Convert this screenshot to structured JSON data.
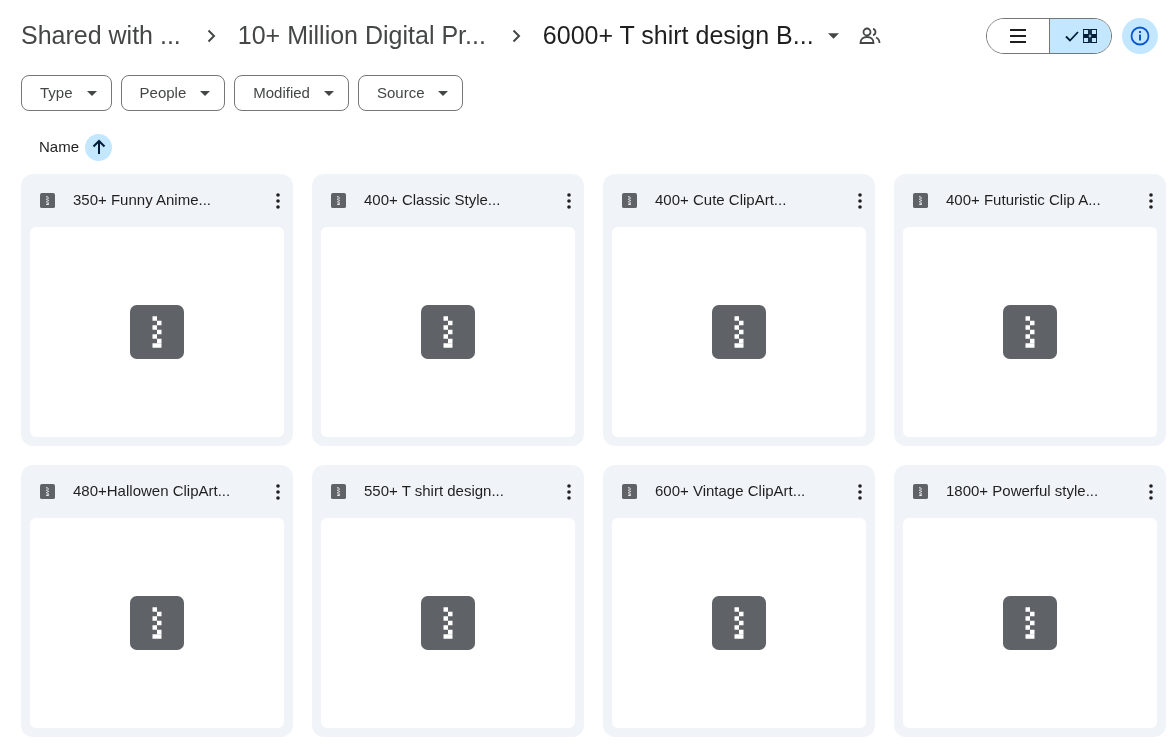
{
  "breadcrumbs": [
    {
      "label": "Shared with ..."
    },
    {
      "label": "10+ Million Digital Pr..."
    },
    {
      "label": "6000+ T shirt design B..."
    }
  ],
  "view_toggle": [
    {
      "kind": "list",
      "selected": false
    },
    {
      "kind": "grid",
      "selected": true
    }
  ],
  "filters": [
    {
      "label": "Type"
    },
    {
      "label": "People"
    },
    {
      "label": "Modified"
    },
    {
      "label": "Source"
    }
  ],
  "sort": {
    "label": "Name"
  },
  "files": [
    {
      "name": "350+ Funny Anime..."
    },
    {
      "name": "400+ Classic Style..."
    },
    {
      "name": "400+ Cute ClipArt..."
    },
    {
      "name": "400+ Futuristic Clip A..."
    },
    {
      "name": "480+Hallowen ClipArt..."
    },
    {
      "name": "550+ T shirt design..."
    },
    {
      "name": "600+ Vintage ClipArt..."
    },
    {
      "name": "1800+ Powerful style..."
    }
  ]
}
